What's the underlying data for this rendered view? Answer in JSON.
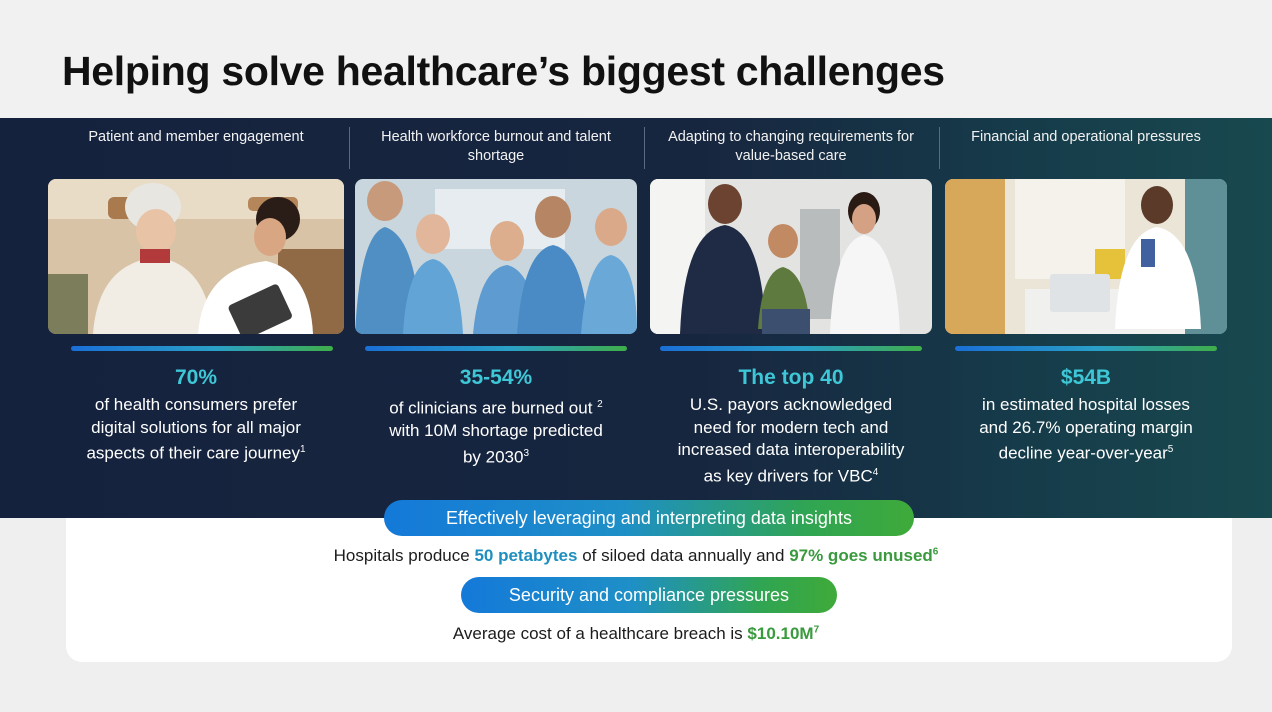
{
  "title": "Helping solve healthcare’s biggest challenges",
  "columns": [
    {
      "header": "Patient and member engagement",
      "image_alt": "elderly-patient-with-doctor",
      "stat": "70%",
      "desc_lines": [
        "of health consumers prefer",
        "digital solutions for all major",
        "aspects of their care journey"
      ],
      "footnote": "1"
    },
    {
      "header": "Health workforce burnout and talent shortage",
      "image_alt": "group-of-clinicians",
      "stat": "35-54%",
      "desc_lines": [
        "of clinicians are burned out",
        "with 10M shortage predicted",
        "by 2030"
      ],
      "footnote_a": "2",
      "footnote_b": "3"
    },
    {
      "header": "Adapting to changing requirements for value-based care",
      "image_alt": "father-child-doctor",
      "stat": "The top 40",
      "desc_lines": [
        "U.S. payors acknowledged",
        "need for modern tech and",
        "increased data interoperability",
        "as key drivers for VBC"
      ],
      "footnote": "4"
    },
    {
      "header": "Financial and operational pressures",
      "image_alt": "doctor-at-laptop",
      "stat": "$54B",
      "desc_lines": [
        "in estimated hospital losses",
        "and 26.7% operating margin",
        "decline year-over-year"
      ],
      "footnote": "5"
    }
  ],
  "insights": {
    "pill": "Effectively leveraging and interpreting data insights",
    "prefix": "Hospitals produce",
    "hl1": "50 petabytes",
    "middle": "of siloed data annually and",
    "hl2": "97% goes unused",
    "footnote": "6"
  },
  "security": {
    "pill": "Security and compliance pressures",
    "prefix": "Average cost of a healthcare breach is",
    "hl": "$10.10M",
    "footnote": "7"
  },
  "colors": {
    "band_dark": "#15223e",
    "band_teal": "#18494f",
    "stat_teal": "#3ec7d6",
    "accent_blue": "#1479d9",
    "accent_green": "#3faa3a"
  }
}
